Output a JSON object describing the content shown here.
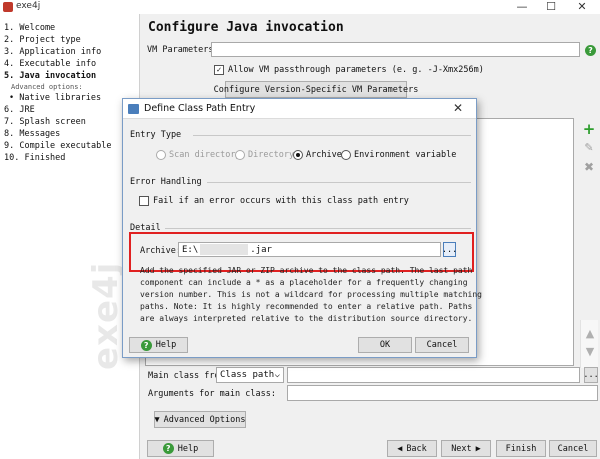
{
  "window": {
    "title": "exe4j",
    "minimize": "—",
    "maximize": "☐",
    "close": "✕"
  },
  "steps": [
    {
      "label": "1.  Welcome"
    },
    {
      "label": "2.  Project type"
    },
    {
      "label": "3.  Application info"
    },
    {
      "label": "4.  Executable info"
    },
    {
      "label": "5.  Java invocation"
    },
    {
      "label": "Advanced options:"
    },
    {
      "label": "• Native libraries"
    },
    {
      "label": "6.  JRE"
    },
    {
      "label": "7.  Splash screen"
    },
    {
      "label": "8.  Messages"
    },
    {
      "label": "9.  Compile executable"
    },
    {
      "label": "10.  Finished"
    }
  ],
  "brand": "exe4j",
  "main": {
    "heading": "Configure Java invocation",
    "vm_parameters_label": "VM Parameters:",
    "vm_parameters_value": "",
    "allow_passthrough_label": "Allow VM passthrough parameters (e. g. -J-Xmx256m)",
    "allow_passthrough_checked": "✓",
    "configure_version_button": "Configure Version-Specific VM Parameters",
    "main_class_from_label": "Main class from",
    "main_class_source": "Class path",
    "main_class_value": "",
    "arguments_label": "Arguments for main class:",
    "arguments_value": "",
    "advanced_options_button": "Advanced Options",
    "ellipsis": "..."
  },
  "side_buttons": {
    "add": "+",
    "edit": "✎",
    "remove": "✖",
    "up": "▲",
    "down": "▼"
  },
  "footer": {
    "help": "Help",
    "back": "Back",
    "next": "Next",
    "finish": "Finish",
    "cancel": "Cancel"
  },
  "dialog": {
    "title": "Define Class Path Entry",
    "close": "✕",
    "entry_type_label": "Entry Type",
    "entry_types": [
      {
        "label": "Scan directory"
      },
      {
        "label": "Directory"
      },
      {
        "label": "Archive"
      },
      {
        "label": "Environment variable"
      }
    ],
    "selected_entry_type": "Archive",
    "error_handling_label": "Error Handling",
    "fail_on_error_label": "Fail if an error occurs with this class path entry",
    "detail_label": "Detail",
    "archive_label": "Archive:",
    "archive_value_prefix": "E:\\",
    "archive_value_suffix": ".jar",
    "browse": "...",
    "description_lines": [
      "Add the specified JAR or ZIP archive to the class path. The last path",
      "component can include a * as a placeholder for a frequently changing",
      "version number. This is not a wildcard for processing multiple matching",
      "paths. Note: It is highly recommended to enter a relative path. Paths",
      "are always interpreted relative to the distribution source directory."
    ],
    "help_button": "Help",
    "ok_button": "OK",
    "cancel_button": "Cancel"
  },
  "colors": {
    "highlight": "#e02020",
    "help_green": "#3a9a3a",
    "add_green": "#2e9e2e"
  }
}
